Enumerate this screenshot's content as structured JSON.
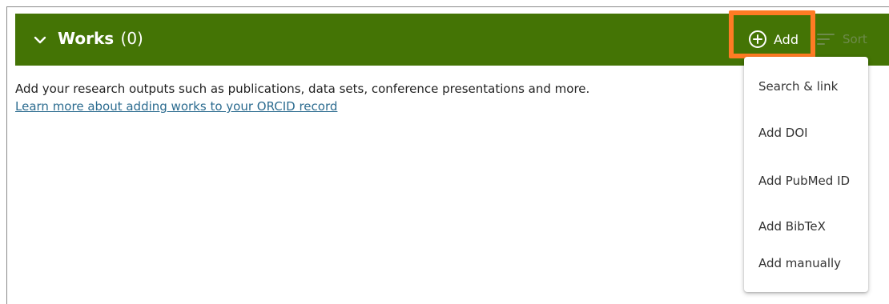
{
  "section": {
    "title": "Works",
    "count": "(0)",
    "add_label": "Add",
    "sort_label": "Sort"
  },
  "body": {
    "description": "Add your research outputs such as publications, data sets, conference presentations and more.",
    "learn_more_link": "Learn more about adding works to your ORCID record"
  },
  "add_menu": {
    "items": [
      {
        "label": "Search & link"
      },
      {
        "label": "Add DOI"
      },
      {
        "label": "Add PubMed ID"
      },
      {
        "label": "Add BibTeX"
      },
      {
        "label": "Add manually"
      }
    ]
  },
  "colors": {
    "header_bg": "#447405",
    "highlight": "#ff7b24",
    "link": "#2b6b8f"
  },
  "icons": {
    "expand": "chevron-down-icon",
    "add": "plus-circle-icon",
    "sort": "sort-lines-icon"
  }
}
